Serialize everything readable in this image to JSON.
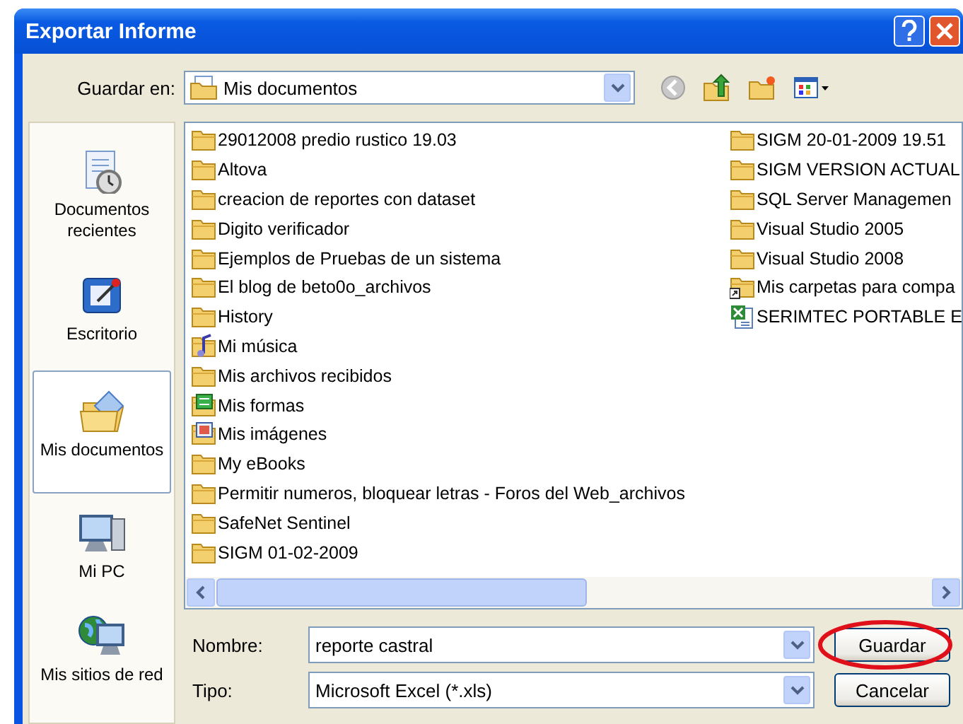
{
  "window": {
    "title": "Exportar Informe"
  },
  "toolbar": {
    "label": "Guardar en:",
    "location": "Mis documentos"
  },
  "places": [
    {
      "label": "Documentos recientes",
      "kind": "recent",
      "selected": false
    },
    {
      "label": "Escritorio",
      "kind": "desktop",
      "selected": false
    },
    {
      "label": "Mis documentos",
      "kind": "documents",
      "selected": true
    },
    {
      "label": "Mi PC",
      "kind": "computer",
      "selected": false
    },
    {
      "label": "Mis sitios de red",
      "kind": "network",
      "selected": false
    }
  ],
  "files": [
    {
      "name": "29012008 predio rustico 19.03",
      "kind": "folder"
    },
    {
      "name": "Altova",
      "kind": "folder"
    },
    {
      "name": "creacion de reportes con dataset",
      "kind": "folder"
    },
    {
      "name": "Digito verificador",
      "kind": "folder"
    },
    {
      "name": "Ejemplos de Pruebas de un sistema",
      "kind": "folder"
    },
    {
      "name": "El blog de beto0o_archivos",
      "kind": "folder"
    },
    {
      "name": "History",
      "kind": "folder"
    },
    {
      "name": "Mi música",
      "kind": "music"
    },
    {
      "name": "Mis archivos recibidos",
      "kind": "folder"
    },
    {
      "name": "Mis formas",
      "kind": "forms"
    },
    {
      "name": "Mis imágenes",
      "kind": "images"
    },
    {
      "name": "My eBooks",
      "kind": "folder"
    },
    {
      "name": "Permitir numeros, bloquear letras - Foros del Web_archivos",
      "kind": "folder"
    },
    {
      "name": "SafeNet Sentinel",
      "kind": "folder"
    },
    {
      "name": "SIGM 01-02-2009",
      "kind": "folder"
    },
    {
      "name": "SIGM 20-01-2009 19.51",
      "kind": "folder"
    },
    {
      "name": "SIGM VERSION ACTUAL",
      "kind": "folder"
    },
    {
      "name": "SQL Server Managemen",
      "kind": "folder"
    },
    {
      "name": "Visual Studio 2005",
      "kind": "folder"
    },
    {
      "name": "Visual Studio 2008",
      "kind": "folder"
    },
    {
      "name": "Mis carpetas para compa",
      "kind": "shared"
    },
    {
      "name": "SERIMTEC PORTABLE E",
      "kind": "excel"
    }
  ],
  "name_field": {
    "label": "Nombre:",
    "value": "reporte castral"
  },
  "type_field": {
    "label": "Tipo:",
    "value": "Microsoft Excel (*.xls)"
  },
  "buttons": [
    {
      "label": "Guardar",
      "highlighted": true
    },
    {
      "label": "Cancelar",
      "highlighted": false
    }
  ]
}
